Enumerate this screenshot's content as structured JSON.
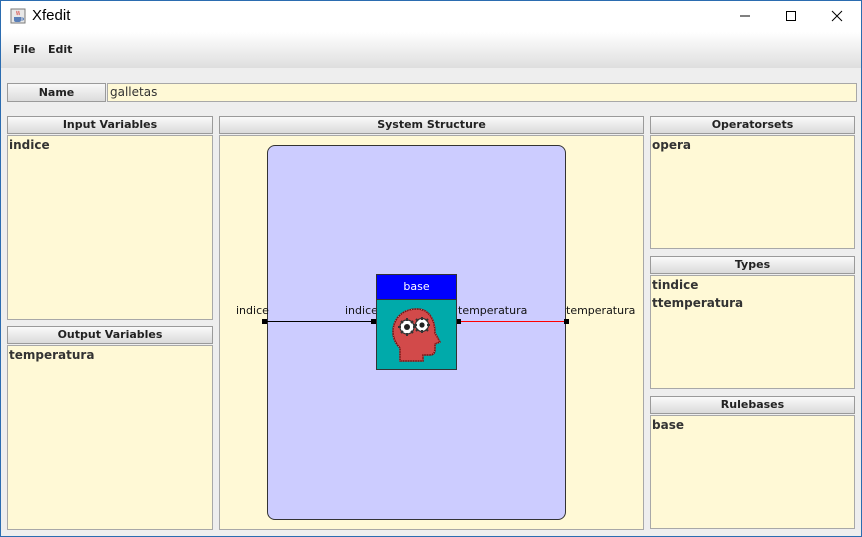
{
  "window": {
    "title": "Xfedit"
  },
  "menu": {
    "file": "File",
    "edit": "Edit"
  },
  "name_row": {
    "label": "Name",
    "value": "galletas"
  },
  "input_variables": {
    "header": "Input Variables",
    "items": [
      "indice"
    ]
  },
  "output_variables": {
    "header": "Output Variables",
    "items": [
      "temperatura"
    ]
  },
  "system_structure": {
    "header": "System Structure",
    "rulebase_block": {
      "title": "base",
      "input_port": "indice",
      "output_port": "temperatura"
    },
    "system_input_label": "indice",
    "system_output_label": "temperatura"
  },
  "operatorsets": {
    "header": "Operatorsets",
    "items": [
      "opera"
    ]
  },
  "types": {
    "header": "Types",
    "items": [
      "tindice",
      "ttemperatura"
    ]
  },
  "rulebases": {
    "header": "Rulebases",
    "items": [
      "base"
    ]
  },
  "colors": {
    "panel_bg": "#fff9d6",
    "system_bg": "#ccccff",
    "rulebase_header": "#0000ff",
    "rulebase_body": "#00aaaa",
    "output_wire": "#ff0000"
  },
  "icons": {
    "app": "java-coffee-cup-icon",
    "minimize": "minimize-icon",
    "maximize": "maximize-icon",
    "close": "close-icon",
    "rulebase": "head-gears-icon"
  }
}
